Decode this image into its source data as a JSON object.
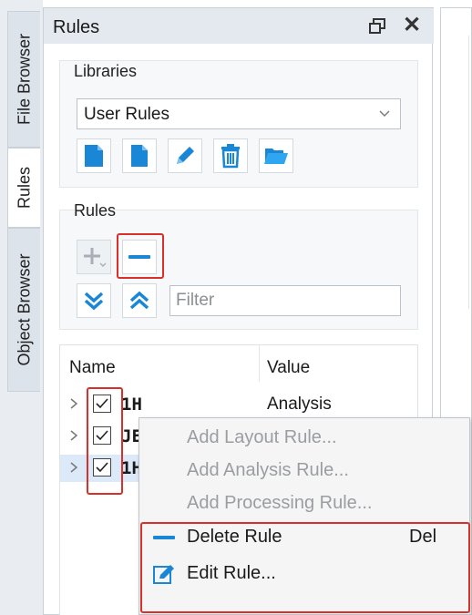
{
  "tabs": [
    {
      "label": "File Browser"
    },
    {
      "label": "Rules"
    },
    {
      "label": "Object Browser"
    }
  ],
  "panel": {
    "title": "Rules"
  },
  "libraries": {
    "label": "Libraries",
    "selected": "User Rules",
    "toolbar_icons": [
      "new-library-icon",
      "new-document-icon",
      "edit-pencil-icon",
      "trash-icon",
      "open-folder-icon"
    ]
  },
  "rules": {
    "label": "Rules",
    "filter_placeholder": "Filter",
    "toolbar_icons": [
      "add-icon",
      "remove-icon",
      "expand-all-icon",
      "collapse-all-icon"
    ]
  },
  "tree": {
    "columns": [
      "Name",
      "Value"
    ],
    "rows": [
      {
        "name": "1H",
        "value": "Analysis",
        "checked": true
      },
      {
        "name": "JE",
        "value": "",
        "checked": true
      },
      {
        "name": "1H",
        "value": "",
        "checked": true
      }
    ]
  },
  "context_menu": {
    "items": [
      {
        "label": "Add Layout Rule...",
        "enabled": false
      },
      {
        "label": "Add Analysis Rule...",
        "enabled": false
      },
      {
        "label": "Add Processing Rule...",
        "enabled": false
      },
      {
        "label": "Delete Rule",
        "shortcut": "Del",
        "enabled": true,
        "icon": "minus-icon"
      },
      {
        "label": "Edit Rule...",
        "enabled": true,
        "icon": "edit-icon"
      }
    ]
  },
  "colors": {
    "accent_blue": "#1a86d6",
    "highlight_red": "#d9312a"
  }
}
